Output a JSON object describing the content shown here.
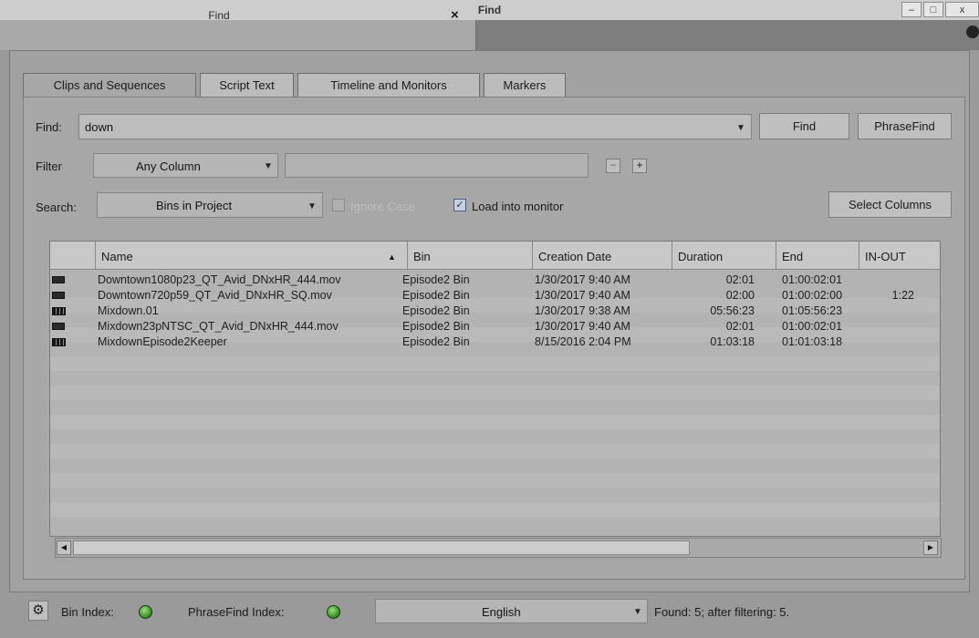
{
  "window": {
    "title": "Find",
    "minimize": "–",
    "maximize": "□",
    "close": "x"
  },
  "doc_tab": {
    "label": "Find",
    "close": "×"
  },
  "tabs": [
    "Clips and Sequences",
    "Script Text",
    "Timeline and Monitors",
    "Markers"
  ],
  "find": {
    "label": "Find:",
    "value": "down",
    "find_button": "Find",
    "phrasefind_button": "PhraseFind"
  },
  "filter": {
    "label": "Filter",
    "column_select": "Any Column",
    "minus_button": "–",
    "plus_button": "+"
  },
  "search": {
    "label": "Search:",
    "scope_select": "Bins in Project",
    "ignore_case_label": "Ignore Case",
    "ignore_case_checked": false,
    "load_monitor_label": "Load into monitor",
    "load_monitor_checked": true,
    "select_columns_button": "Select Columns"
  },
  "table": {
    "columns": [
      "Name",
      "Bin",
      "Creation Date",
      "Duration",
      "End",
      "IN-OUT"
    ],
    "sort_indicator": "▲",
    "rows": [
      {
        "icon": "clip-icon",
        "name": "Downtown1080p23_QT_Avid_DNxHR_444.mov",
        "bin": "Episode2 Bin",
        "created": "1/30/2017 9:40 AM",
        "duration": "02:01",
        "end": "01:00:02:01",
        "inout": ""
      },
      {
        "icon": "clip-icon",
        "name": "Downtown720p59_QT_Avid_DNxHR_SQ.mov",
        "bin": "Episode2 Bin",
        "created": "1/30/2017 9:40 AM",
        "duration": "02:00",
        "end": "01:00:02:00",
        "inout": "1:22"
      },
      {
        "icon": "sequence-icon",
        "name": "Mixdown.01",
        "bin": "Episode2 Bin",
        "created": "1/30/2017 9:38 AM",
        "duration": "05:56:23",
        "end": "01:05:56:23",
        "inout": ""
      },
      {
        "icon": "clip-icon",
        "name": "Mixdown23pNTSC_QT_Avid_DNxHR_444.mov",
        "bin": "Episode2 Bin",
        "created": "1/30/2017 9:40 AM",
        "duration": "02:01",
        "end": "01:00:02:01",
        "inout": ""
      },
      {
        "icon": "sequence-icon",
        "name": "MixdownEpisode2Keeper",
        "bin": "Episode2 Bin",
        "created": "8/15/2016 2:04 PM",
        "duration": "01:03:18",
        "end": "01:01:03:18",
        "inout": ""
      }
    ]
  },
  "status": {
    "bin_index_label": "Bin Index:",
    "phrasefind_index_label": "PhraseFind Index:",
    "language_select": "English",
    "result_text": "Found: 5; after filtering: 5."
  }
}
